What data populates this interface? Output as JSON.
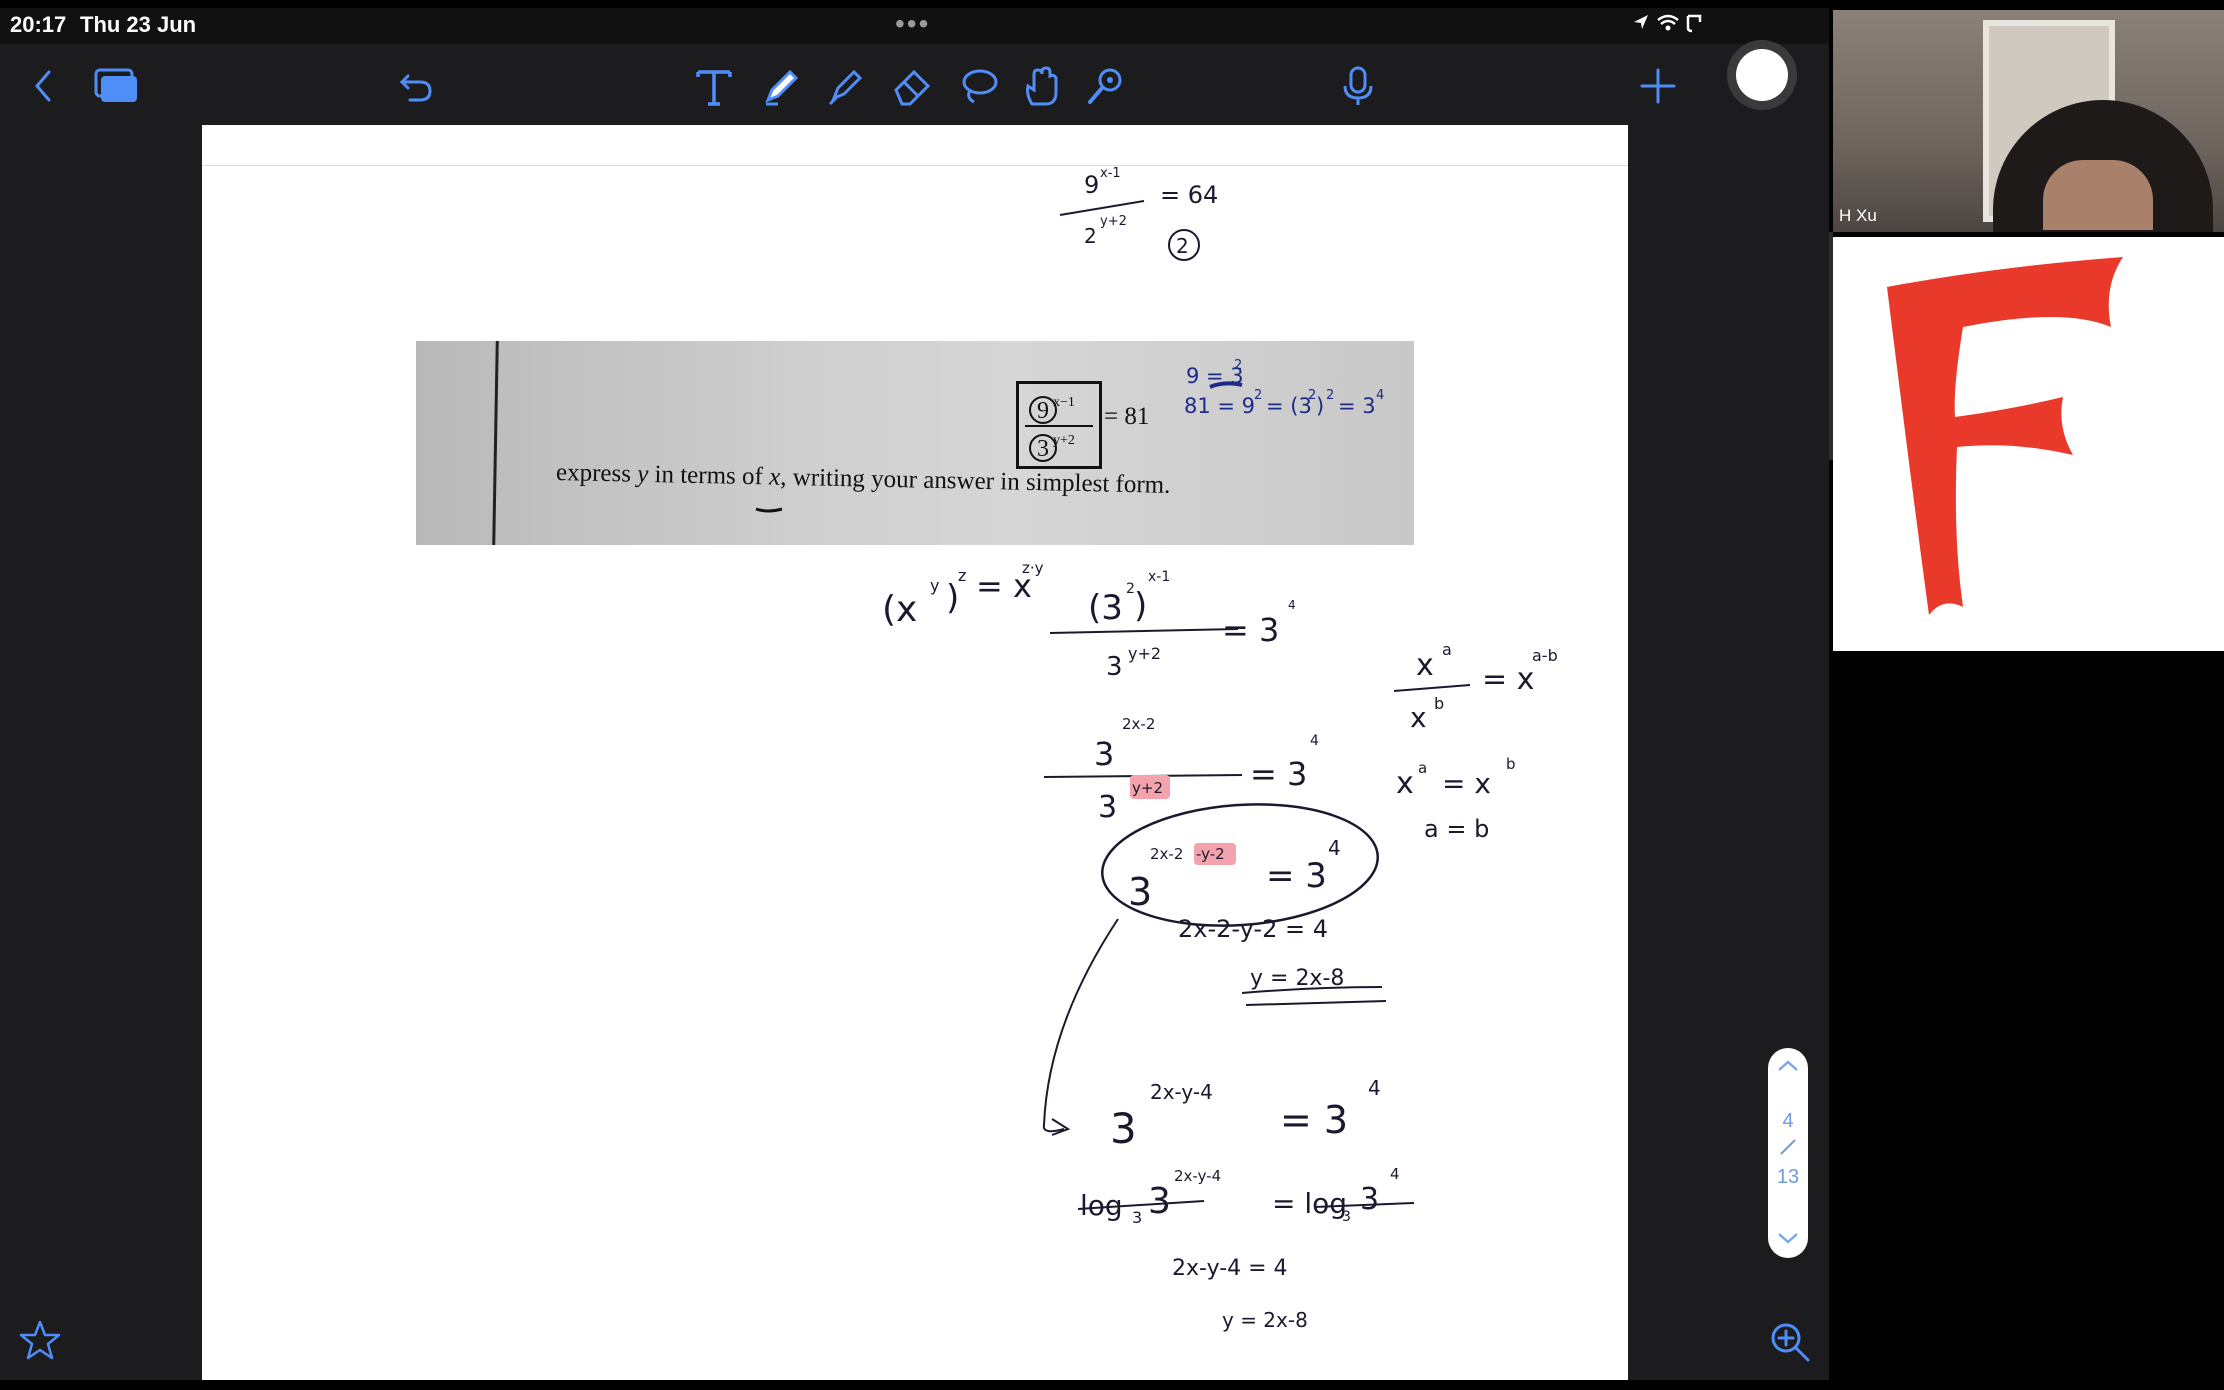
{
  "status_bar": {
    "time": "20:17",
    "date": "Thu 23 Jun",
    "multitask_dots": "•••"
  },
  "toolbar": {
    "tools": [
      {
        "name": "back",
        "icon": "chevron-left-icon"
      },
      {
        "name": "page-thumbnails",
        "icon": "thumbnails-icon"
      },
      {
        "name": "undo",
        "icon": "undo-icon"
      },
      {
        "name": "text-tool",
        "icon": "text-tool-icon"
      },
      {
        "name": "pen-tool",
        "icon": "pen-icon"
      },
      {
        "name": "highlighter-tool",
        "icon": "highlighter-icon"
      },
      {
        "name": "eraser-tool",
        "icon": "eraser-icon"
      },
      {
        "name": "lasso-tool",
        "icon": "lasso-icon"
      },
      {
        "name": "hand-tool",
        "icon": "hand-icon"
      },
      {
        "name": "laser-tool",
        "icon": "laser-icon"
      },
      {
        "name": "microphone",
        "icon": "microphone-icon"
      },
      {
        "name": "add",
        "icon": "plus-icon"
      }
    ]
  },
  "problem": {
    "prompt_prefix": "express ",
    "var_y": "y",
    "prompt_mid": " in terms of ",
    "var_x": "x",
    "prompt_suffix": ", writing your answer in simplest form.",
    "numerator_base": "9",
    "numerator_exp": "x−1",
    "denominator_base": "3",
    "denominator_exp": "y+2",
    "equals_value": "= 81"
  },
  "handwriting": {
    "top_fraction_num": "9",
    "top_fraction_num_exp": "x-1",
    "top_fraction_den": "2",
    "top_fraction_den_exp": "y+2",
    "top_fraction_equals": "= 64",
    "top_label": "2",
    "note_1": "9 = 3",
    "note_1_exp": "2",
    "note_2": "81 = 9",
    "note_2_exp": "2",
    "note_2_rest": "= (3",
    "note_2_rest_exp_inner": "2",
    "note_2_rest_close": ")",
    "note_2_rest_exp_outer": "2",
    "note_2_final": "= 3",
    "note_2_final_exp": "4",
    "rule_power": "(x",
    "rule_power_exp_y": "y",
    "rule_power_close": ")",
    "rule_power_exp_z": "z",
    "rule_power_result": "= x",
    "rule_power_result_exp": "z·y",
    "step1_num": "(3",
    "step1_num_exp_inner": "2",
    "step1_num_close": ")",
    "step1_num_exp": "x-1",
    "step1_den": "3",
    "step1_den_exp": "y+2",
    "step1_rhs": "= 3",
    "step1_rhs_exp": "4",
    "rule_div_num": "x",
    "rule_div_num_exp": "a",
    "rule_div_den": "x",
    "rule_div_den_exp": "b",
    "rule_div_result": "= x",
    "rule_div_result_exp": "a-b",
    "step2_num": "3",
    "step2_num_exp": "2x-2",
    "step2_den": "3",
    "step2_den_exp": "y+2",
    "step2_rhs": "= 3",
    "step2_rhs_exp": "4",
    "rule_eq_lhs": "x",
    "rule_eq_lhs_exp": "a",
    "rule_eq_mid": "= x",
    "rule_eq_mid_exp": "b",
    "rule_eq_result": "a = b",
    "step3_base": "3",
    "step3_exp_a": "2x-2",
    "step3_exp_b": "-y-2",
    "step3_rhs": "= 3",
    "step3_rhs_exp": "4",
    "step4": "2x-2-y-2 = 4",
    "step5": "y = 2x-8",
    "alt1_base": "3",
    "alt1_exp": "2x-y-4",
    "alt1_rhs": "= 3",
    "alt1_rhs_exp": "4",
    "alt2_log": "log",
    "alt2_sub": "3",
    "alt2_base": "3",
    "alt2_exp": "2x-y-4",
    "alt2_rhs_log": "= log",
    "alt2_rhs_sub": "3",
    "alt2_rhs_base": "3",
    "alt2_rhs_exp": "4",
    "alt3": "2x-y-4  =  4",
    "alt4": "y =  2x-8"
  },
  "page_indicator": {
    "current": "4",
    "total": "13"
  },
  "video": {
    "participant_name": "H Xu",
    "shared_logo": "F"
  },
  "colors": {
    "accent_blue": "#4f8ef7",
    "ink_dark": "#1a1a2e",
    "ink_blue": "#1d2a8a",
    "highlight_pink": "#f4a3ad",
    "logo_red": "#e8392b"
  }
}
